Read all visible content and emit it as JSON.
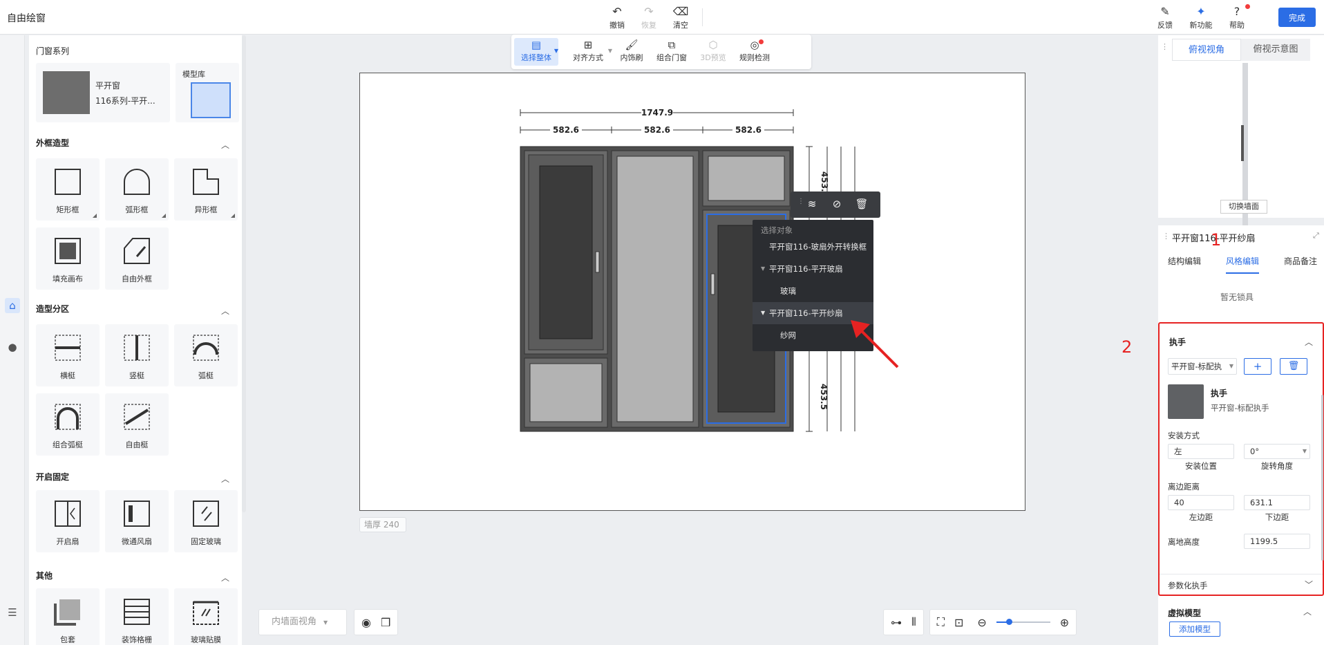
{
  "app": {
    "title": "自由绘窗"
  },
  "top_tools": [
    {
      "label": "撤销",
      "icon": "undo-icon",
      "enabled": true
    },
    {
      "label": "恢复",
      "icon": "redo-icon",
      "enabled": false
    },
    {
      "label": "清空",
      "icon": "eraser-icon",
      "enabled": true
    }
  ],
  "right_tools": [
    {
      "label": "反馈",
      "icon": "feedback-icon"
    },
    {
      "label": "新功能",
      "icon": "new-feature-icon"
    },
    {
      "label": "帮助",
      "icon": "help-icon"
    }
  ],
  "done_label": "完成",
  "library": {
    "series_title": "门窗系列",
    "series_name": "平开窗",
    "series_sub": "116系列-平开...",
    "model_lib": "模型库",
    "sections": [
      {
        "title": "外框造型",
        "items": [
          "矩形框",
          "弧形框",
          "异形框",
          "填充画布",
          "自由外框"
        ]
      },
      {
        "title": "造型分区",
        "items": [
          "横梃",
          "竖梃",
          "弧梃",
          "组合弧梃",
          "自由梃"
        ]
      },
      {
        "title": "开启固定",
        "items": [
          "开启扇",
          "微通风扇",
          "固定玻璃"
        ]
      },
      {
        "title": "其他",
        "items": [
          "包套",
          "装饰格栅",
          "玻璃贴膜"
        ]
      }
    ]
  },
  "canvas_toolbar": [
    {
      "label": "选择整体",
      "icon": "select-all-icon",
      "selected": true,
      "enabled": true
    },
    {
      "label": "对齐方式",
      "icon": "align-icon",
      "selected": false,
      "enabled": true
    },
    {
      "label": "内饰刷",
      "icon": "brush-icon",
      "selected": false,
      "enabled": true
    },
    {
      "label": "组合门窗",
      "icon": "combine-icon",
      "selected": false,
      "enabled": true
    },
    {
      "label": "3D预览",
      "icon": "3d-preview-icon",
      "selected": false,
      "enabled": false
    },
    {
      "label": "规则检测",
      "icon": "rule-check-icon",
      "selected": false,
      "enabled": true
    }
  ],
  "dimensions": {
    "total": "1747.9",
    "parts": [
      "582.6",
      "582.6",
      "582.6"
    ],
    "vertical_top": "453.",
    "vertical_bottom": "453.5"
  },
  "wall_thickness": "墙厚 240",
  "context_menu": {
    "title": "选择对象",
    "items": [
      {
        "label": "平开窗116-玻扇外开转换框",
        "level": 0,
        "expandable": false,
        "active": false
      },
      {
        "label": "平开窗116-平开玻扇",
        "level": 0,
        "expandable": true,
        "active": false
      },
      {
        "label": "玻璃",
        "level": 1,
        "expandable": false,
        "active": false
      },
      {
        "label": "平开窗116-平开纱扇",
        "level": 0,
        "expandable": true,
        "active": true
      },
      {
        "label": "纱网",
        "level": 1,
        "expandable": false,
        "active": false
      }
    ]
  },
  "bottom": {
    "view_select": "内墙面视角"
  },
  "preview": {
    "tabs": [
      "俯视视角",
      "俯视示意图"
    ],
    "switch_wall": "切换墙面"
  },
  "editor": {
    "title": "平开窗116-平开纱扇",
    "tabs": [
      "结构编辑",
      "风格编辑",
      "商品备注"
    ],
    "active_tab": 1,
    "lock_empty": "暂无锁具",
    "handle": {
      "title": "执手",
      "select_value": "平开窗-标配执",
      "item_name": "执手",
      "item_sub": "平开窗-标配执手",
      "install_label": "安装方式",
      "install_pos_value": "左",
      "install_pos_caption": "安装位置",
      "rotate_value": "0°",
      "rotate_caption": "旋转角度",
      "edge_label": "离边距离",
      "left_value": "40",
      "left_caption": "左边距",
      "bottom_value": "631.1",
      "bottom_caption": "下边距",
      "height_label": "离地高度",
      "height_value": "1199.5",
      "param_label": "参数化执手"
    },
    "virtual": {
      "title": "虚拟模型",
      "add_label": "添加模型"
    }
  },
  "annotations": {
    "one": "1",
    "two": "2"
  },
  "colors": {
    "accent": "#2b6de5",
    "highlight": "#e62222",
    "frame": "#4d4d4d",
    "glass": "#b3b3b3"
  }
}
